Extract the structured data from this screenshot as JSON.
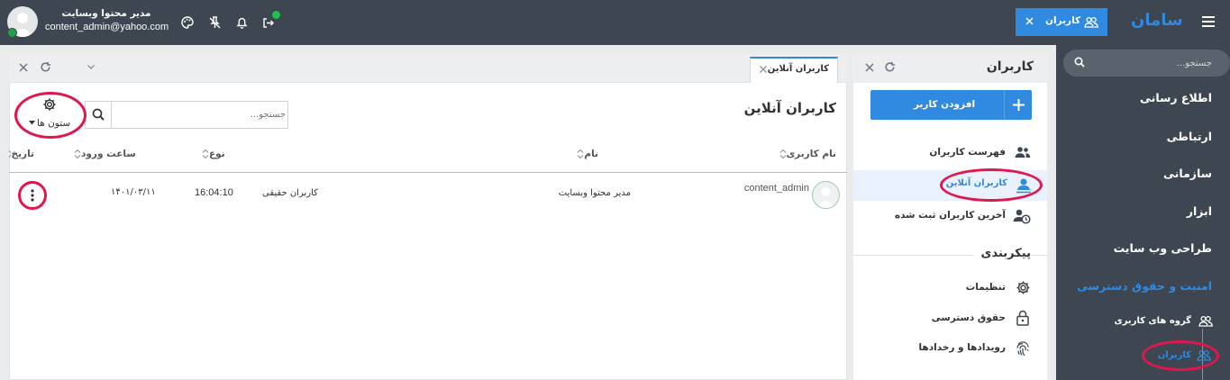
{
  "topbar": {
    "brand": "سامان",
    "open_tab_label": "کاربران",
    "user_display_name": "مدیر محتوا وبسایت",
    "user_email": "content_admin@yahoo.com"
  },
  "sidebar": {
    "search_placeholder": "جستجو...",
    "items": [
      {
        "label": "اطلاع رسانی"
      },
      {
        "label": "ارتباطی"
      },
      {
        "label": "سازمانی"
      },
      {
        "label": "ابزار"
      },
      {
        "label": "طراحی وب سایت"
      },
      {
        "label": "امنیت و حقوق دسترسی"
      }
    ],
    "subitems": [
      {
        "label": "گروه های کاربری"
      },
      {
        "label": "کاربران"
      }
    ],
    "active_color": "#2f8ae0"
  },
  "users_panel": {
    "title": "کاربران",
    "add_user_label": "افزودن کاربر",
    "menu": [
      {
        "label": "فهرست کاربران"
      },
      {
        "label": "کاربران آنلاین"
      },
      {
        "label": "آخرین کاربران ثبت شده"
      }
    ],
    "config_section_title": "پیکربندی",
    "config_menu": [
      {
        "label": "تنظیمات"
      },
      {
        "label": "حقوق دسترسی"
      },
      {
        "label": "رویدادها و رخدادها"
      }
    ]
  },
  "main": {
    "tab_label": "کاربران آنلاین",
    "page_title": "کاربران آنلاین",
    "search_placeholder": "جستجو...",
    "columns_label": "ستون ها",
    "table": {
      "headers": [
        "نام کاربری",
        "نام",
        "نوع",
        "ساعت ورود",
        "تاریخ"
      ],
      "rows": [
        {
          "username": "content_admin",
          "name": "مدیر محتوا وبسایت",
          "type": "کاربران حقیقی",
          "login_time": "16:04:10",
          "date": "۱۴۰۱/۰۳/۱۱"
        }
      ]
    }
  },
  "colors": {
    "header_bg": "#3d4651",
    "accent_blue": "#2f8ae0",
    "highlight_red": "#e0174e"
  }
}
